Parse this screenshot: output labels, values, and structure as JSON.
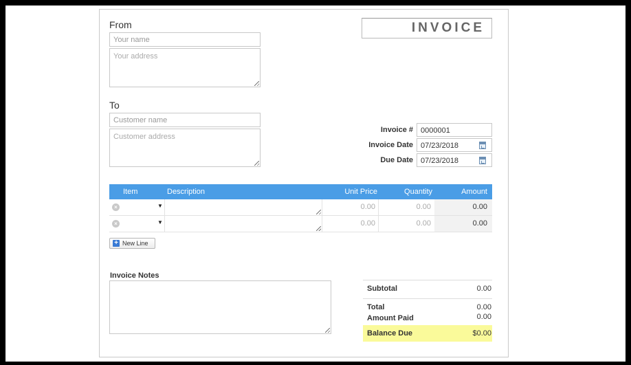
{
  "from": {
    "heading": "From",
    "name_placeholder": "Your name",
    "address_placeholder": "Your address"
  },
  "to": {
    "heading": "To",
    "name_placeholder": "Customer name",
    "address_placeholder": "Customer address"
  },
  "title": "INVOICE",
  "meta": {
    "invoice_no_label": "Invoice #",
    "invoice_no_value": "0000001",
    "invoice_date_label": "Invoice Date",
    "invoice_date_value": "07/23/2018",
    "due_date_label": "Due Date",
    "due_date_value": "07/23/2018",
    "calendar_icon": "calendar-icon"
  },
  "items": {
    "columns": [
      "Item",
      "Description",
      "Unit Price",
      "Quantity",
      "Amount"
    ],
    "rows": [
      {
        "unit_price": "0.00",
        "quantity": "0.00",
        "amount": "0.00"
      },
      {
        "unit_price": "0.00",
        "quantity": "0.00",
        "amount": "0.00"
      }
    ],
    "new_line_label": "New Line",
    "header_color": "#4a9de6"
  },
  "notes": {
    "label": "Invoice Notes"
  },
  "totals": {
    "subtotal_label": "Subtotal",
    "subtotal_value": "0.00",
    "total_label": "Total",
    "total_value": "0.00",
    "amount_paid_label": "Amount Paid",
    "amount_paid_value": "0.00",
    "balance_due_label": "Balance Due",
    "balance_due_value": "$0.00",
    "balance_highlight": "#fafa9a"
  }
}
